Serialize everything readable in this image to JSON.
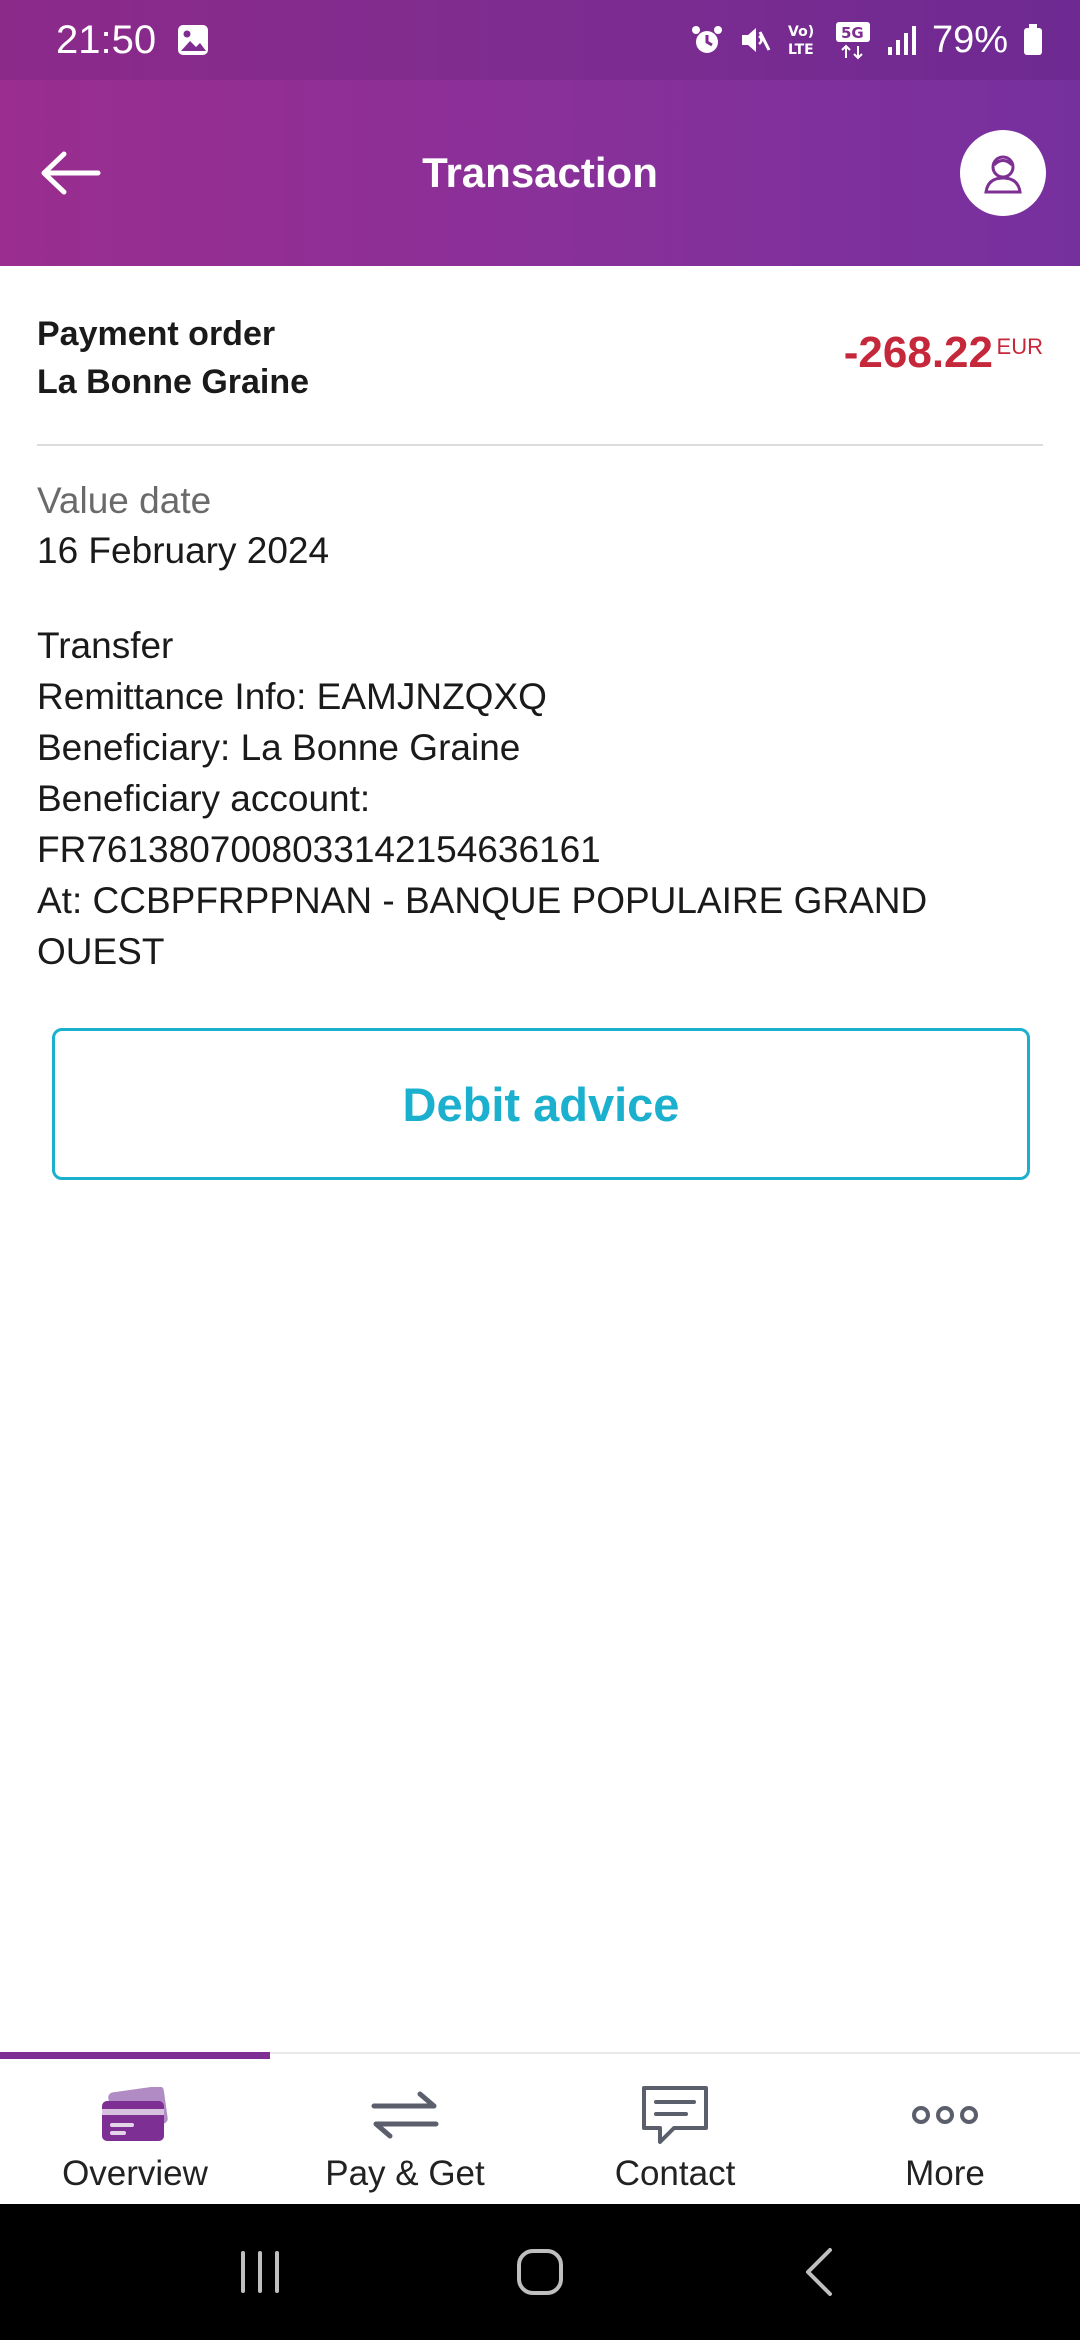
{
  "status_bar": {
    "time": "21:50",
    "network_label": "5G",
    "volte_label": "Vo) LTE",
    "battery": "79%"
  },
  "app_bar": {
    "title": "Transaction",
    "gradient_start": "#9a2d8f",
    "gradient_end": "#76309e"
  },
  "transaction": {
    "type": "Payment order",
    "counterparty": "La Bonne Graine",
    "amount": "-268.22",
    "currency": "EUR",
    "amount_color": "#c6283b",
    "value_date_label": "Value date",
    "value_date": "16 February 2024",
    "details": [
      "Transfer",
      "Remittance Info: EAMJNZQXQ",
      "Beneficiary: La Bonne Graine",
      "Beneficiary account:",
      "FR7613807008033142154636161",
      "At: CCBPFRPPNAN - BANQUE POPULAIRE GRAND OUEST"
    ]
  },
  "actions": {
    "debit_advice_label": "Debit advice",
    "accent_color": "#1cb0cf"
  },
  "bottom_nav": {
    "items": [
      {
        "label": "Overview",
        "icon": "cards-icon",
        "active": true
      },
      {
        "label": "Pay & Get",
        "icon": "transfer-arrows-icon",
        "active": false
      },
      {
        "label": "Contact",
        "icon": "chat-bubble-icon",
        "active": false
      },
      {
        "label": "More",
        "icon": "more-dots-icon",
        "active": false
      }
    ],
    "active_color": "#7d2f93"
  },
  "system_nav": {
    "buttons": [
      "recent-apps",
      "home",
      "back"
    ]
  }
}
